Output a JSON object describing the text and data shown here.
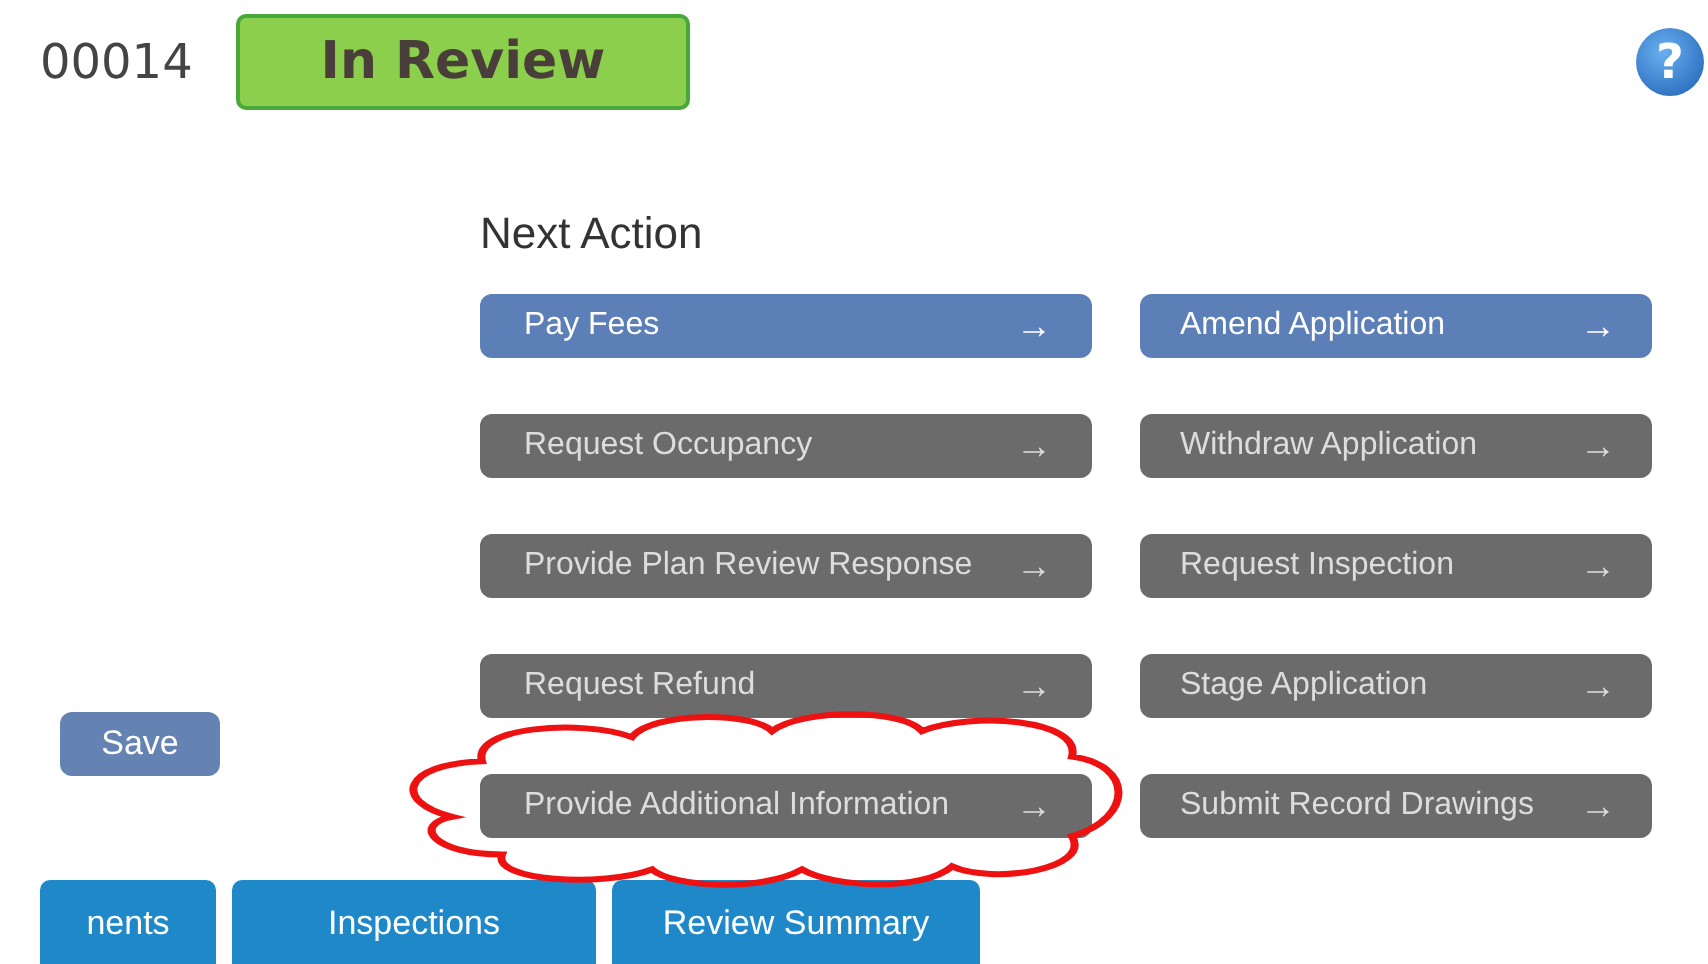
{
  "record": {
    "number": "00014",
    "status": "In Review"
  },
  "next_action": {
    "title": "Next Action",
    "buttons": [
      {
        "label": "Pay Fees",
        "arrow": "→",
        "kind": "primary"
      },
      {
        "label": "Amend Application",
        "arrow": "→",
        "kind": "primary"
      },
      {
        "label": "Request Occupancy",
        "arrow": "→",
        "kind": "secondary"
      },
      {
        "label": "Withdraw Application",
        "arrow": "→",
        "kind": "secondary"
      },
      {
        "label": "Provide Plan Review Response",
        "arrow": "→",
        "kind": "secondary"
      },
      {
        "label": "Request Inspection",
        "arrow": "→",
        "kind": "secondary"
      },
      {
        "label": "Request Refund",
        "arrow": "→",
        "kind": "secondary"
      },
      {
        "label": "Stage Application",
        "arrow": "→",
        "kind": "secondary"
      },
      {
        "label": "Provide Additional Information",
        "arrow": "→",
        "kind": "secondary"
      },
      {
        "label": "Submit Record Drawings",
        "arrow": "→",
        "kind": "secondary"
      }
    ]
  },
  "save_button": "Save",
  "help": "?",
  "tabs": [
    {
      "label": "nents"
    },
    {
      "label": "Inspections"
    },
    {
      "label": "Review Summary"
    }
  ]
}
